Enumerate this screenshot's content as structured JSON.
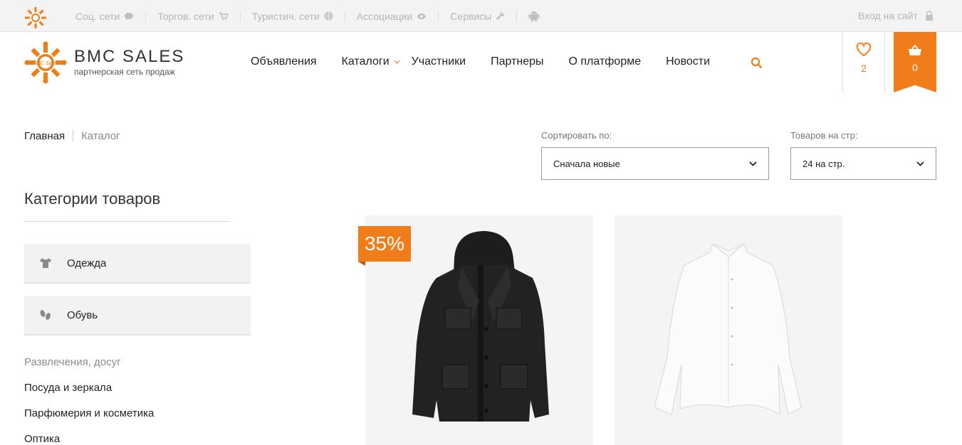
{
  "topbar": {
    "links": [
      {
        "label": "Соц. сети",
        "icon": "chat-icon"
      },
      {
        "label": "Торгов. сети",
        "icon": "cart-small-icon"
      },
      {
        "label": "Туристич. сети",
        "icon": "globe-icon"
      },
      {
        "label": "Ассоциации",
        "icon": "eye-icon"
      },
      {
        "label": "Сервисы",
        "icon": "wrench-icon"
      },
      {
        "label": "",
        "icon": "android-icon"
      }
    ],
    "login_label": "Вход на сайт"
  },
  "logo": {
    "brand": "BMC SALES",
    "tagline": "партнерская сеть продаж",
    "mark_text": "BMC Sales"
  },
  "nav": {
    "items": [
      "Объявления",
      "Каталоги",
      "Участники",
      "Партнеры",
      "О платформе",
      "Новости"
    ]
  },
  "favorites": {
    "count": "2"
  },
  "cart": {
    "count": "0"
  },
  "breadcrumb": {
    "home": "Главная",
    "current": "Каталог"
  },
  "sort": {
    "label": "Сортировать по:",
    "value": "Сначала новые"
  },
  "per_page": {
    "label": "Товаров на стр:",
    "value": "24 на стр."
  },
  "sidebar": {
    "title": "Категории товаров",
    "boxes": [
      {
        "label": "Одежда",
        "icon": "tshirt-icon"
      },
      {
        "label": "Обувь",
        "icon": "footprints-icon"
      }
    ],
    "links": [
      "Развлечения, досуг",
      "Посуда и зеркала",
      "Парфюмерия и косметика",
      "Оптика"
    ]
  },
  "products": [
    {
      "name": "jacket",
      "discount": "35%"
    },
    {
      "name": "shirt",
      "discount": ""
    }
  ],
  "colors": {
    "accent": "#f07d1a"
  }
}
